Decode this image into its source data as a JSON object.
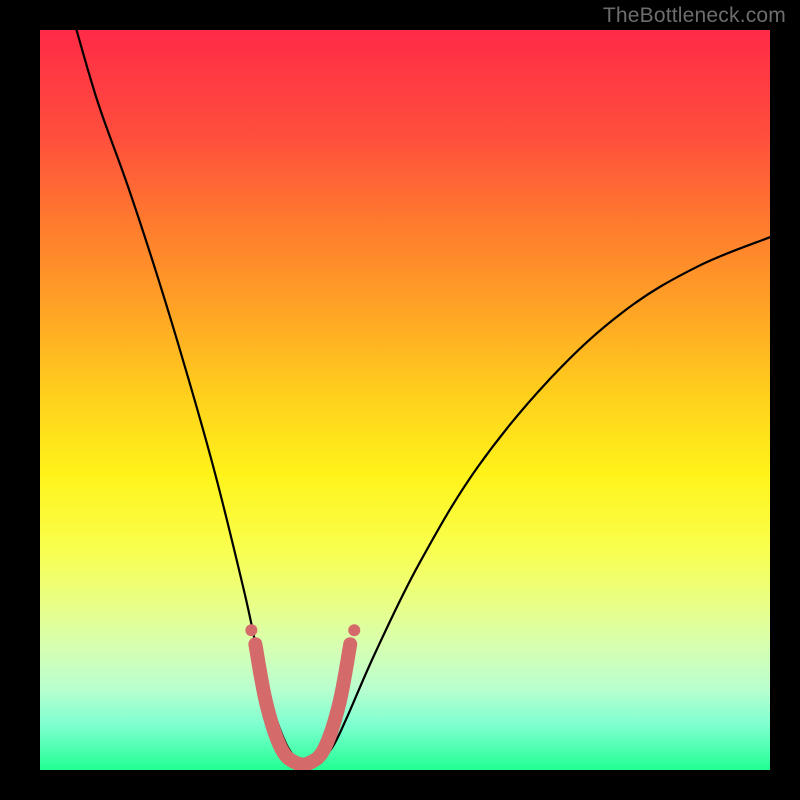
{
  "watermark": "TheBottleneck.com",
  "colors": {
    "frame": "#000000",
    "curve": "#000000",
    "overlay_stroke": "#d46a6a",
    "overlay_fill": "#d46a6a"
  },
  "chart_data": {
    "type": "line",
    "title": "",
    "xlabel": "",
    "ylabel": "",
    "xlim": [
      0,
      100
    ],
    "ylim": [
      0,
      100
    ],
    "note": "No numeric axis ticks or data labels are visible; curve values are estimated from pixel positions on a normalized 0–100 grid. y=0 is bottom, y=100 is top.",
    "series": [
      {
        "name": "bottleneck-curve",
        "x": [
          5,
          8,
          12,
          16,
          20,
          24,
          28,
          30,
          32,
          34,
          36,
          38,
          40,
          42,
          46,
          52,
          60,
          70,
          80,
          90,
          100
        ],
        "y": [
          100,
          90,
          79,
          67,
          54,
          40,
          24,
          15,
          8,
          3,
          1,
          1,
          3,
          7,
          16,
          28,
          41,
          53,
          62,
          68,
          72
        ]
      }
    ],
    "overlay_segment": {
      "description": "Highlighted pink/coral segment at bottom of the V",
      "x": [
        29.5,
        31,
        33,
        35,
        37,
        39,
        41,
        42.5
      ],
      "y": [
        17,
        9,
        3,
        1,
        1,
        3,
        9,
        17
      ]
    },
    "background_gradient": {
      "orientation": "top-to-bottom",
      "stops": [
        {
          "pos": 0.0,
          "color": "#ff2b47"
        },
        {
          "pos": 0.5,
          "color": "#ffd21c"
        },
        {
          "pos": 0.75,
          "color": "#eaff82"
        },
        {
          "pos": 1.0,
          "color": "#22ff93"
        }
      ]
    }
  }
}
